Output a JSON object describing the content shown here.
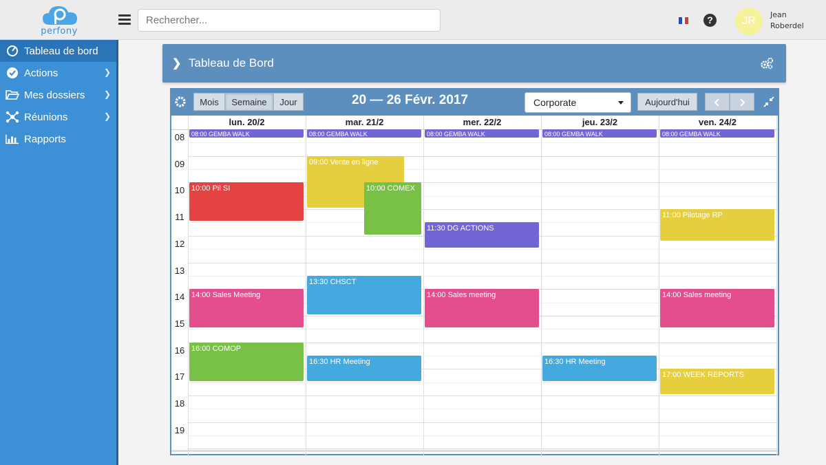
{
  "app": {
    "logo_text": "perfony",
    "colors": {
      "topbar": "#ececec",
      "sidebar": "#3d8fd6",
      "sidebar_active": "#2b74b8",
      "header_panel": "#5c8fbe"
    }
  },
  "topbar": {
    "search_placeholder": "Rechercher...",
    "language_icon": "flag-fr-icon",
    "help_icon": "question-circle-icon",
    "user": {
      "initials": "JR",
      "first_name": "Jean",
      "last_name": "Roberdel"
    }
  },
  "sidebar": {
    "items": [
      {
        "label": "Tableau de bord",
        "icon": "dashboard-icon",
        "active": true,
        "has_submenu": false
      },
      {
        "label": "Actions",
        "icon": "check-circle-icon",
        "active": false,
        "has_submenu": true
      },
      {
        "label": "Mes dossiers",
        "icon": "folder-open-icon",
        "active": false,
        "has_submenu": true
      },
      {
        "label": "Réunions",
        "icon": "network-icon",
        "active": false,
        "has_submenu": true
      },
      {
        "label": "Rapports",
        "icon": "bar-chart-icon",
        "active": false,
        "has_submenu": false
      }
    ]
  },
  "header": {
    "title": "Tableau de Bord",
    "settings_icon": "gears-icon"
  },
  "calendar": {
    "views": [
      "Mois",
      "Semaine",
      "Jour"
    ],
    "active_view": "Semaine",
    "range": "20 — 26 Févr. 2017",
    "selected_calendar": "Corporate",
    "today_label": "Aujourd'hui",
    "prev_label": "<",
    "next_label": ">",
    "days": [
      "lun. 20/2",
      "mar. 21/2",
      "mer. 22/2",
      "jeu. 23/2",
      "ven. 24/2"
    ],
    "hours": [
      "08",
      "09",
      "10",
      "11",
      "12",
      "13",
      "14",
      "15",
      "16",
      "17",
      "18",
      "19"
    ],
    "events": [
      {
        "title": "08:00 GEMBA WALK",
        "day": 0,
        "start": 8.0,
        "end": 8.35,
        "color": "#7266d6",
        "col_start": 0,
        "col_end": 1
      },
      {
        "title": "08:00 GEMBA WALK",
        "day": 1,
        "start": 8.0,
        "end": 8.35,
        "color": "#7266d6",
        "col_start": 0,
        "col_end": 1
      },
      {
        "title": "08:00 GEMBA WALK",
        "day": 2,
        "start": 8.0,
        "end": 8.35,
        "color": "#7266d6",
        "col_start": 0,
        "col_end": 1
      },
      {
        "title": "08:00 GEMBA WALK",
        "day": 3,
        "start": 8.0,
        "end": 8.35,
        "color": "#7266d6",
        "col_start": 0,
        "col_end": 1
      },
      {
        "title": "08:00 GEMBA WALK",
        "day": 4,
        "start": 8.0,
        "end": 8.35,
        "color": "#7266d6",
        "col_start": 0,
        "col_end": 1
      },
      {
        "title": "09:00 Vente en ligne",
        "day": 1,
        "start": 9.0,
        "end": 11.0,
        "color": "#e6cf3e",
        "col_start": 0,
        "col_end": 0.85
      },
      {
        "title": "10:00 Pil SI",
        "day": 0,
        "start": 10.0,
        "end": 11.5,
        "color": "#e54242",
        "col_start": 0,
        "col_end": 1
      },
      {
        "title": "10:00 COMEX",
        "day": 1,
        "start": 10.0,
        "end": 12.0,
        "color": "#78c046",
        "col_start": 0.5,
        "col_end": 1
      },
      {
        "title": "11:00 Pilotage RP",
        "day": 4,
        "start": 11.0,
        "end": 12.25,
        "color": "#e6cf3e",
        "col_start": 0,
        "col_end": 1
      },
      {
        "title": "11:30 DG ACTIONS",
        "day": 2,
        "start": 11.5,
        "end": 12.5,
        "color": "#7266d6",
        "col_start": 0,
        "col_end": 1
      },
      {
        "title": "13:30 CHSCT",
        "day": 1,
        "start": 13.5,
        "end": 15.0,
        "color": "#43a9de",
        "col_start": 0,
        "col_end": 1
      },
      {
        "title": "14:00 Sales Meeting",
        "day": 0,
        "start": 14.0,
        "end": 15.5,
        "color": "#e44e8c",
        "col_start": 0,
        "col_end": 1
      },
      {
        "title": "14:00 Sales meeting",
        "day": 2,
        "start": 14.0,
        "end": 15.5,
        "color": "#e44e8c",
        "col_start": 0,
        "col_end": 1
      },
      {
        "title": "14:00 Sales meeting",
        "day": 4,
        "start": 14.0,
        "end": 15.5,
        "color": "#e44e8c",
        "col_start": 0,
        "col_end": 1
      },
      {
        "title": "16:00 COMOP",
        "day": 0,
        "start": 16.0,
        "end": 17.5,
        "color": "#78c046",
        "col_start": 0,
        "col_end": 1
      },
      {
        "title": "16:30 HR Meeting",
        "day": 1,
        "start": 16.5,
        "end": 17.5,
        "color": "#43a9de",
        "col_start": 0,
        "col_end": 1
      },
      {
        "title": "16:30 HR Meeting",
        "day": 3,
        "start": 16.5,
        "end": 17.5,
        "color": "#43a9de",
        "col_start": 0,
        "col_end": 1
      },
      {
        "title": "17:00 WEEK REPORTS",
        "day": 4,
        "start": 17.0,
        "end": 18.0,
        "color": "#e6cf3e",
        "col_start": 0,
        "col_end": 1
      }
    ]
  }
}
